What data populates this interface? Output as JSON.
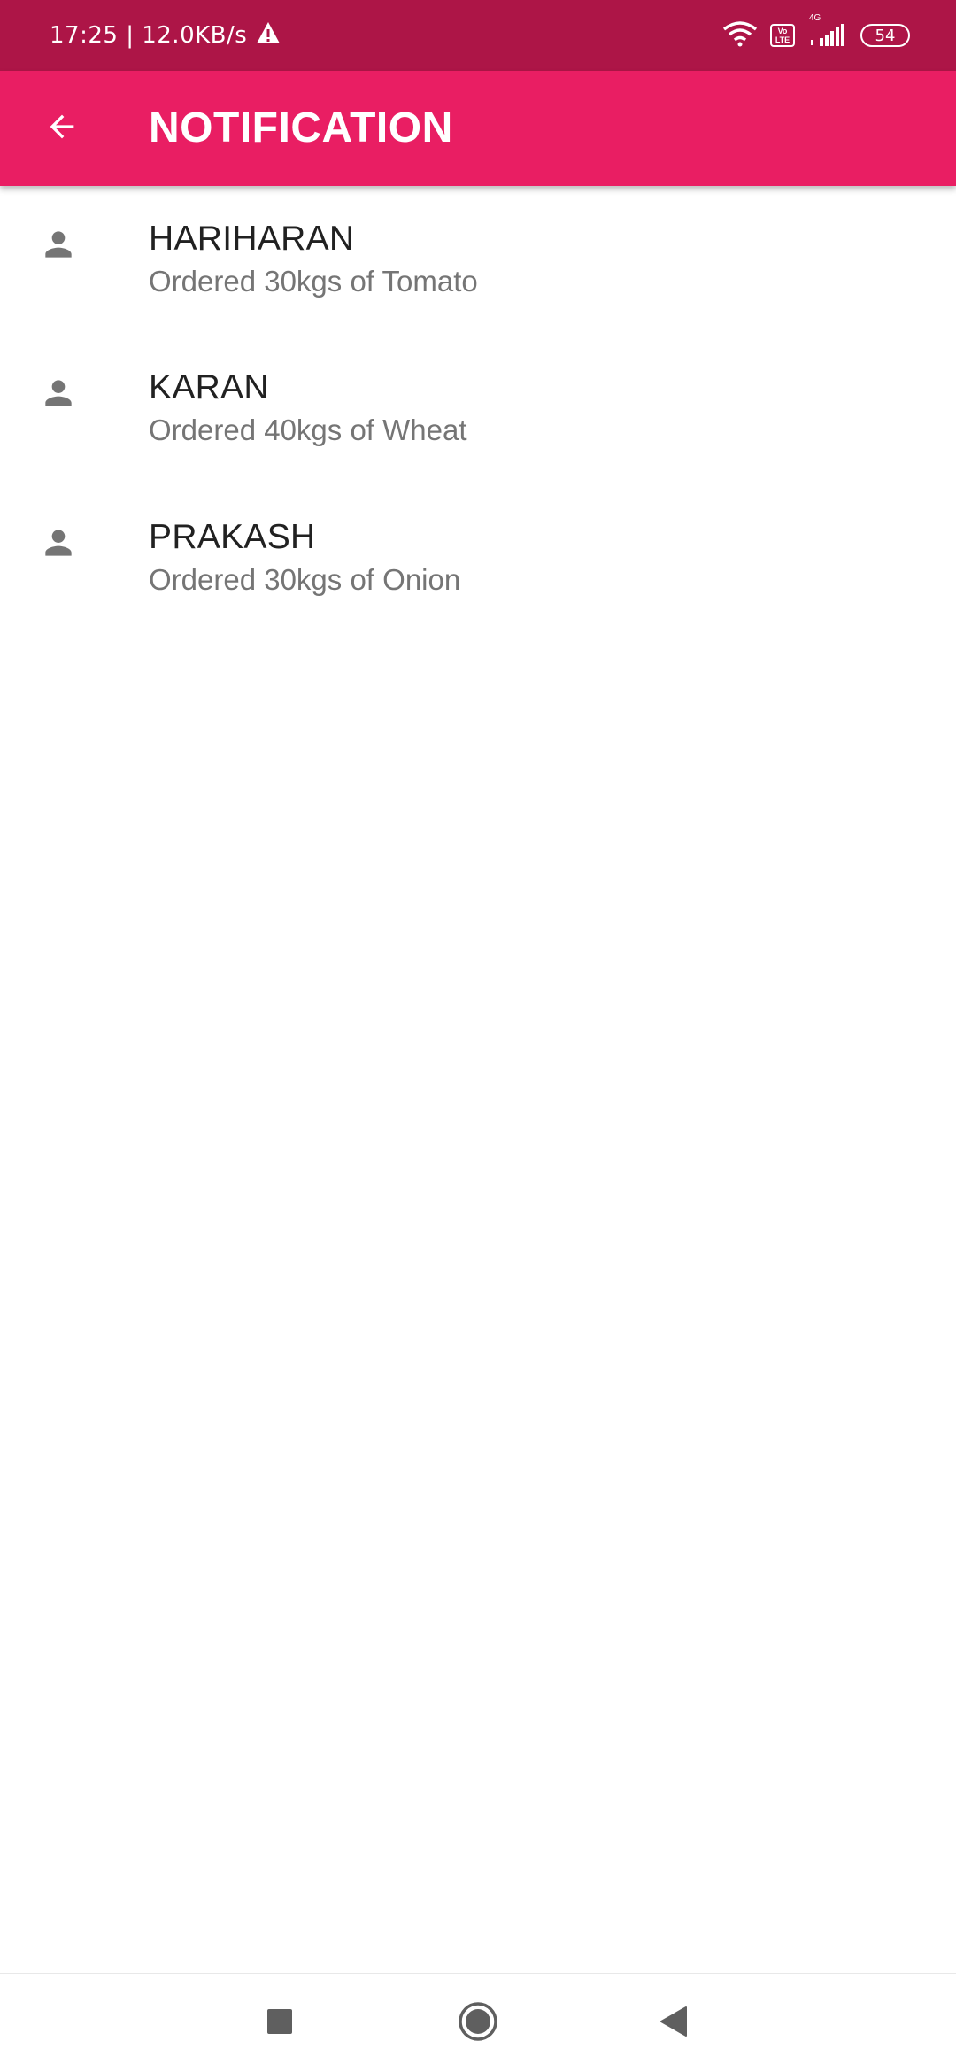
{
  "status_bar": {
    "time_speed": "17:25 | 12.0KB/s",
    "network": "4G",
    "volte_top": "Vo",
    "volte_bottom": "LTE",
    "battery": "54",
    "bar_color": "#AD1547"
  },
  "app_bar": {
    "title": "NOTIFICATION",
    "back_icon": "arrow-back-icon",
    "color": "#E91E63"
  },
  "notifications": [
    {
      "name": "HARIHARAN",
      "message": "Ordered 30kgs of Tomato",
      "icon": "person-icon"
    },
    {
      "name": "KARAN",
      "message": "Ordered 40kgs of Wheat",
      "icon": "person-icon"
    },
    {
      "name": "PRAKASH",
      "message": "Ordered 30kgs of Onion",
      "icon": "person-icon"
    }
  ],
  "nav_bar": {
    "recents_icon": "square-icon",
    "home_icon": "circle-icon",
    "back_icon": "triangle-back-icon"
  }
}
